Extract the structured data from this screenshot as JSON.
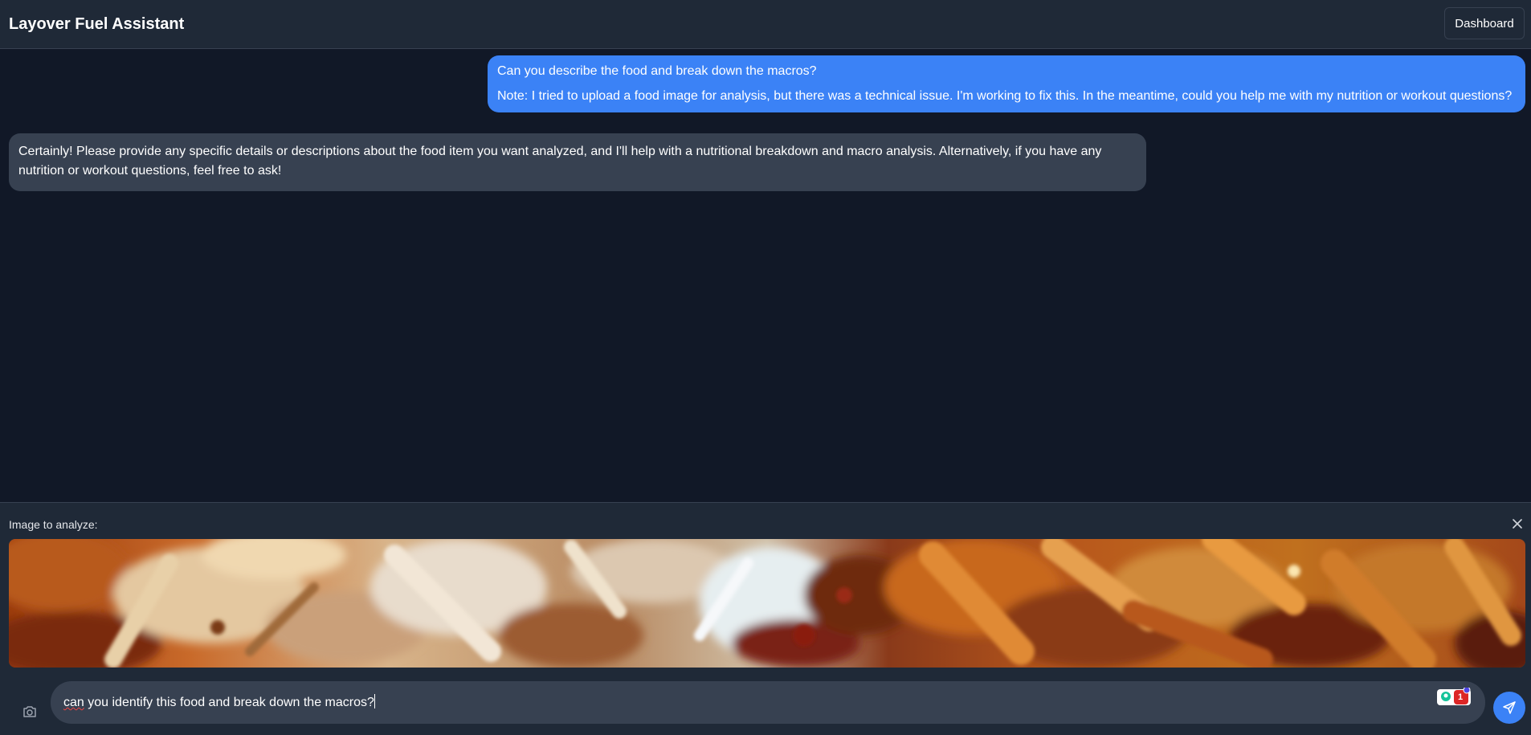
{
  "header": {
    "title": "Layover Fuel Assistant",
    "dashboard_label": "Dashboard"
  },
  "messages": [
    {
      "role": "user",
      "lines": [
        "Can you describe the food and break down the macros?",
        "Note: I tried to upload a food image for analysis, but there was a technical issue. I'm working to fix this. In the meantime, could you help me with my nutrition or workout questions?"
      ]
    },
    {
      "role": "assistant",
      "text": "Certainly! Please provide any specific details or descriptions about the food item you want analyzed, and I'll help with a nutritional breakdown and macro analysis. Alternatively, if you have any nutrition or workout questions, feel free to ask!"
    }
  ],
  "image_preview": {
    "label": "Image to analyze:",
    "close_icon": "close-icon"
  },
  "composer": {
    "value_misspelled": "can",
    "value_rest": " you identify this food and break down the macros?",
    "camera_icon": "camera-icon",
    "send_icon": "send-icon",
    "extension_badge_count": "1",
    "accent": "#3b82f6"
  },
  "colors": {
    "background": "#111827",
    "panel": "#1f2937",
    "bubble_user": "#3b82f6",
    "bubble_assistant": "#374151"
  }
}
